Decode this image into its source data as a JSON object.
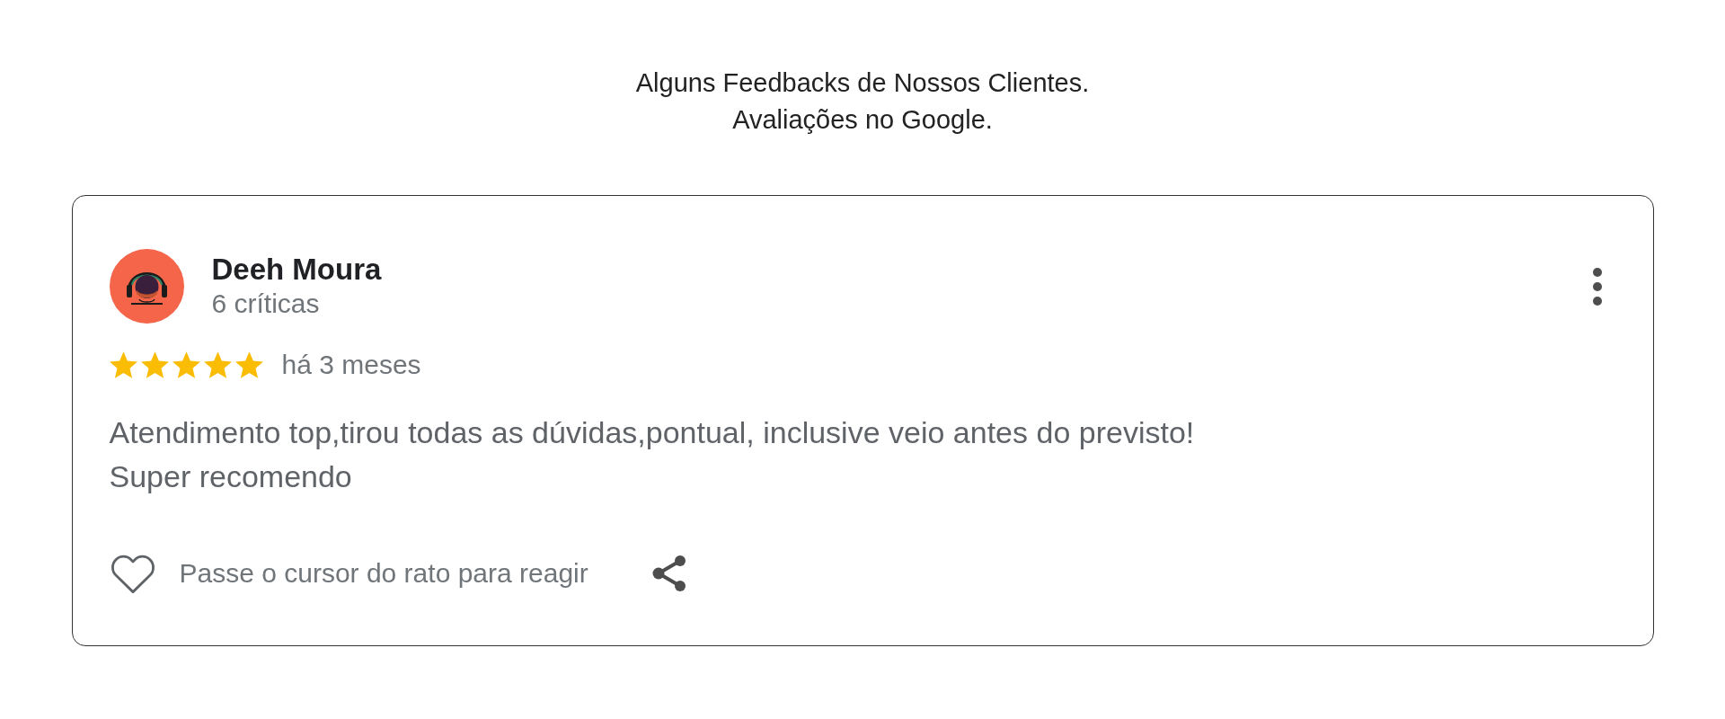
{
  "header": {
    "lines": [
      "Alguns Feedbacks de Nossos Clientes.",
      "Avaliações no Google."
    ]
  },
  "review": {
    "author": "Deeh Moura",
    "review_count": "6 críticas",
    "stars": 5,
    "time": "há 3 meses",
    "text": "Atendimento top,tirou todas as dúvidas,pontual, inclusive veio antes do previsto!\nSuper recomendo",
    "liked": false,
    "reaction_hint": "Passe o cursor do rato para reagir"
  }
}
